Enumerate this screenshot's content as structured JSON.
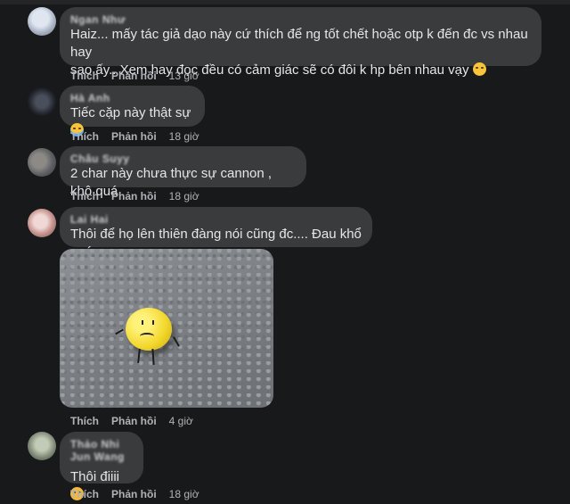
{
  "top_actions": {
    "like": "Thích",
    "reply": "Phản hồi",
    "time": "13 giờ"
  },
  "comments": [
    {
      "author": "Ngan Như",
      "text": "Haiz... mấy tác giả dạo này cứ thích để ng tốt chết hoặc otp k đến đc vs nhau hay\nsao ấy.. Xem hay đọc đều có cảm giác sẽ có đôi k hp bên nhau vạy",
      "emoji": "disappointed-face",
      "like": "Thích",
      "reply": "Phản hồi",
      "time": "13 giờ"
    },
    {
      "author": "Hà Anh",
      "text": "Tiếc cặp này thật sự",
      "emoji": "crying-face",
      "like": "Thích",
      "reply": "Phản hồi",
      "time": "18 giờ"
    },
    {
      "author": "Châu Suyy",
      "text": "2 char này chưa thực sự cannon , khộ quá",
      "like": "Thích",
      "reply": "Phản hồi",
      "time": "18 giờ"
    },
    {
      "author": "Lai Hai",
      "text": "Thôi để họ lên thiên đàng nói cũng đc.... Đau khổ quá",
      "image": "sad-lemon-photo",
      "like": "Thích",
      "reply": "Phản hồi",
      "time": "4 giờ"
    },
    {
      "author": "Thảo Nhi Jun Wang",
      "text": "Thôi điiii",
      "emoji": "pleading-face",
      "like": "Thích",
      "reply": "Phản hồi",
      "time": "18 giờ"
    }
  ],
  "colors": {
    "background": "#18191a",
    "bubble": "#3a3b3c",
    "text": "#e4e6eb",
    "secondary": "#b0b3b8"
  }
}
